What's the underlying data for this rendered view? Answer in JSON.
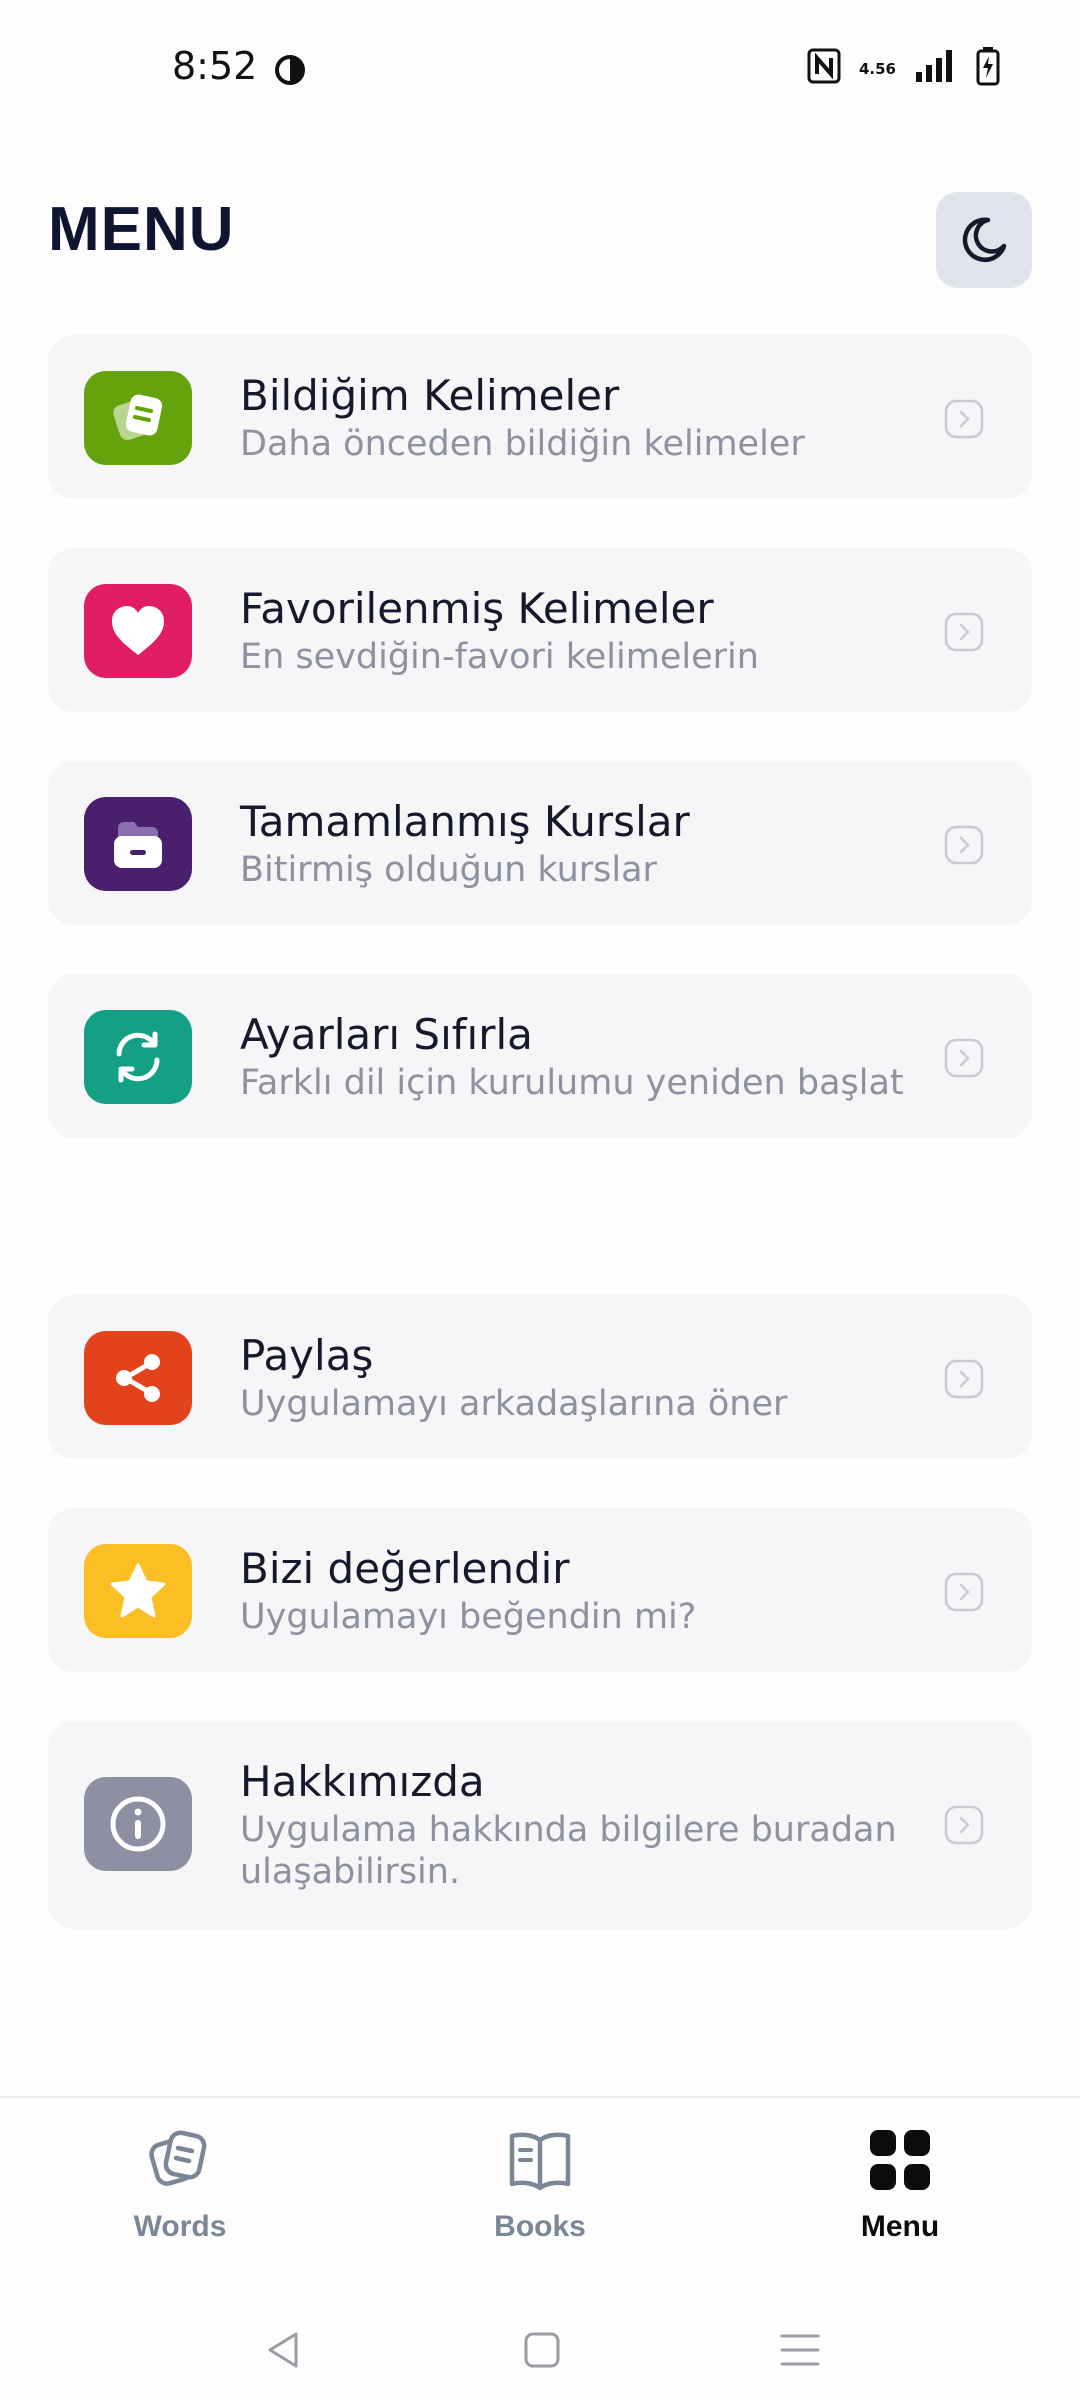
{
  "status_bar": {
    "time": "8:52",
    "network": "4.56"
  },
  "header": {
    "title": "MENU",
    "theme_icon": "moon-icon"
  },
  "menu_items": [
    {
      "title": "Bildiğim Kelimeler",
      "subtitle": "Daha önceden bildiğin kelimeler",
      "icon": "word-cards-icon",
      "color": "#65a30d"
    },
    {
      "title": "Favorilenmiş Kelimeler",
      "subtitle": "En sevdiğin-favori kelimelerin",
      "icon": "heart-icon",
      "color": "#e11d64"
    },
    {
      "title": "Tamamlanmış Kurslar",
      "subtitle": "Bitirmiş olduğun kurslar",
      "icon": "folder-icon",
      "color": "#4a1f6e"
    },
    {
      "title": "Ayarları Sıfırla",
      "subtitle": "Farklı dil için kurulumu yeniden başlat",
      "icon": "refresh-icon",
      "color": "#14a085"
    },
    {
      "title": "Paylaş",
      "subtitle": "Uygulamayı arkadaşlarına öner",
      "icon": "share-icon",
      "color": "#e2421c"
    },
    {
      "title": "Bizi değerlendir",
      "subtitle": "Uygulamayı beğendin mi?",
      "icon": "star-icon",
      "color": "#fbbf24"
    },
    {
      "title": "Hakkımızda",
      "subtitle": "Uygulama hakkında bilgilere buradan ulaşabilirsin.",
      "icon": "info-icon",
      "color": "#8e8fa3"
    }
  ],
  "tabs": [
    {
      "label": "Words",
      "icon": "words-icon",
      "active": false
    },
    {
      "label": "Books",
      "icon": "book-icon",
      "active": false
    },
    {
      "label": "Menu",
      "icon": "grid-icon",
      "active": true
    }
  ],
  "colors": {
    "card_bg": "#f6f6f8",
    "title": "#16182c",
    "subtitle": "#8e91a0",
    "tab_inactive": "#7b8697",
    "tab_active": "#0b0b0b"
  }
}
